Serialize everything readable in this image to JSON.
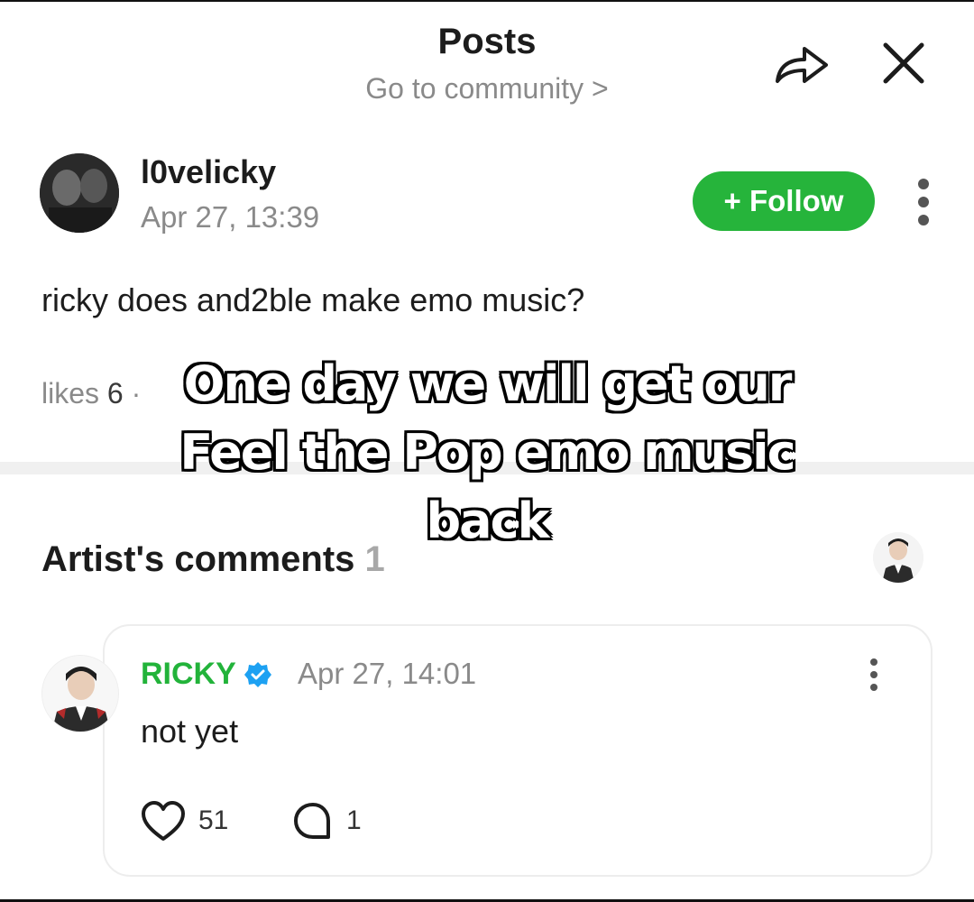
{
  "header": {
    "title": "Posts",
    "subtitle": "Go to community >"
  },
  "post": {
    "username": "l0velicky",
    "date": "Apr 27, 13:39",
    "follow_label": "+ Follow",
    "body": "ricky does and2ble make emo music?",
    "likes_label": "likes",
    "likes_count": "6",
    "separator": "·"
  },
  "artist_comments": {
    "title": "Artist's comments",
    "count": "1",
    "comment": {
      "author": "RICKY",
      "date": "Apr 27, 14:01",
      "text": "not yet",
      "likes": "51",
      "replies": "1"
    }
  },
  "overlay_text": {
    "line1": "One day we will get our",
    "line2": "Feel the Pop emo music",
    "line3": "back"
  },
  "colors": {
    "accent_green": "#26b43b",
    "muted_text": "#8a8a8a",
    "verified_blue": "#1da1f2"
  },
  "icons": [
    "share-icon",
    "close-icon",
    "more-vertical-icon",
    "verified-icon",
    "heart-icon",
    "comment-icon"
  ]
}
